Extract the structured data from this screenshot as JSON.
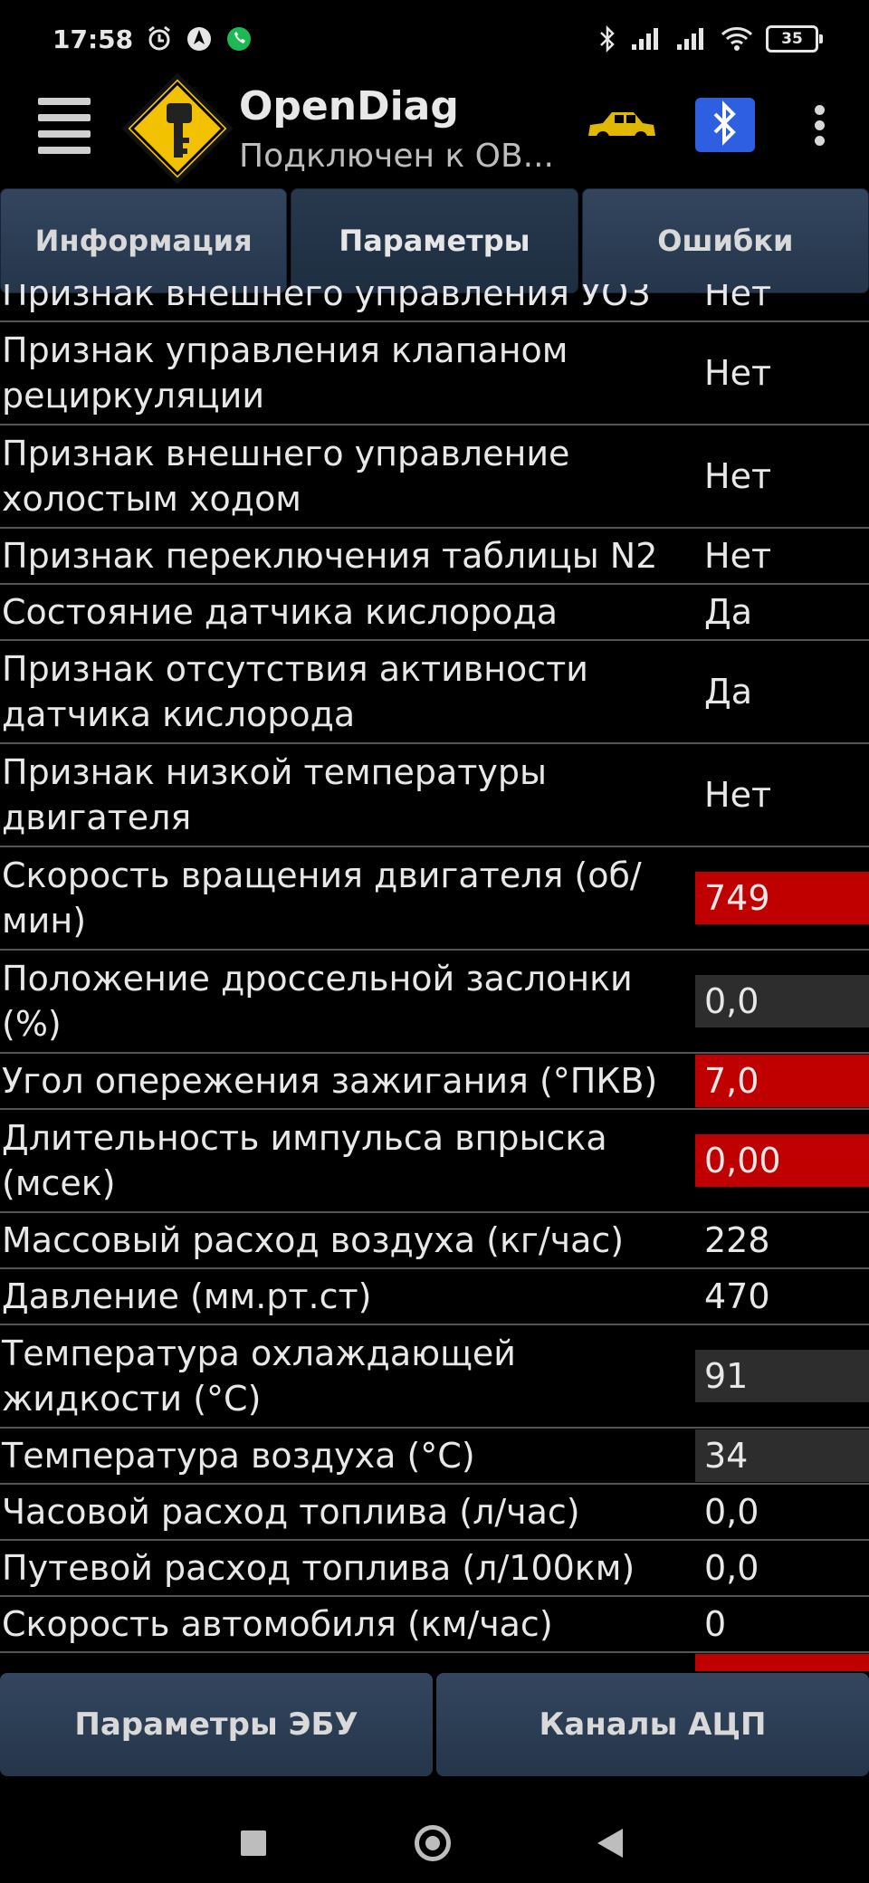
{
  "status_bar": {
    "time": "17:58",
    "battery": "35",
    "icons": [
      "alarm-icon",
      "navigation-icon",
      "phone-call-icon",
      "bluetooth-icon",
      "signal-icon",
      "signal-icon",
      "wifi-icon",
      "battery-icon"
    ]
  },
  "app_bar": {
    "title": "OpenDiag",
    "subtitle": "Подключен к OB...",
    "logo_color": "#f2c200",
    "car_color": "#e0b800",
    "bt_color": "#2d5fe0"
  },
  "tabs": [
    {
      "label": "Информация",
      "active": false
    },
    {
      "label": "Параметры",
      "active": true
    },
    {
      "label": "Ошибки",
      "active": false
    }
  ],
  "parameters": [
    {
      "name": "Признак внешнего управления УОЗ",
      "value": "Нет",
      "hl": ""
    },
    {
      "name": "Признак управления клапаном рециркуляции",
      "value": "Нет",
      "hl": ""
    },
    {
      "name": "Признак внешнего управление холостым ходом",
      "value": "Нет",
      "hl": ""
    },
    {
      "name": "Признак переключения таблицы N2",
      "value": "Нет",
      "hl": ""
    },
    {
      "name": "Состояние датчика кислорода",
      "value": "Да",
      "hl": ""
    },
    {
      "name": "Признак отсутствия активности датчика кислорода",
      "value": "Да",
      "hl": ""
    },
    {
      "name": "Признак низкой температуры двигателя",
      "value": "Нет",
      "hl": ""
    },
    {
      "name": "Скорость вращения двигателя (об/мин)",
      "value": "749",
      "hl": "red"
    },
    {
      "name": "Положение дроссельной заслонки (%)",
      "value": "0,0",
      "hl": "gray"
    },
    {
      "name": "Угол опережения зажигания (°ПКВ)",
      "value": "7,0",
      "hl": "red"
    },
    {
      "name": "Длительность импульса впрыска (мсек)",
      "value": "0,00",
      "hl": "red"
    },
    {
      "name": "Массовый расход воздуха (кг/час)",
      "value": "228",
      "hl": ""
    },
    {
      "name": "Давление (мм.рт.ст)",
      "value": "470",
      "hl": ""
    },
    {
      "name": "Температура охлаждающей жидкости (°C)",
      "value": "91",
      "hl": "gray"
    },
    {
      "name": "Температура воздуха (°C)",
      "value": "34",
      "hl": "gray"
    },
    {
      "name": "Часовой расход топлива (л/час)",
      "value": "0,0",
      "hl": ""
    },
    {
      "name": "Путевой расход топлива (л/100км)",
      "value": "0,0",
      "hl": ""
    },
    {
      "name": "Скорость автомобиля (км/час)",
      "value": "0",
      "hl": ""
    },
    {
      "name": "",
      "value": "",
      "hl": "red"
    }
  ],
  "bottom_buttons": [
    {
      "label": "Параметры ЭБУ"
    },
    {
      "label": "Каналы АЦП"
    }
  ],
  "nav_bar": {
    "icons": [
      "recents-square-icon",
      "home-circle-icon",
      "back-triangle-icon"
    ]
  }
}
